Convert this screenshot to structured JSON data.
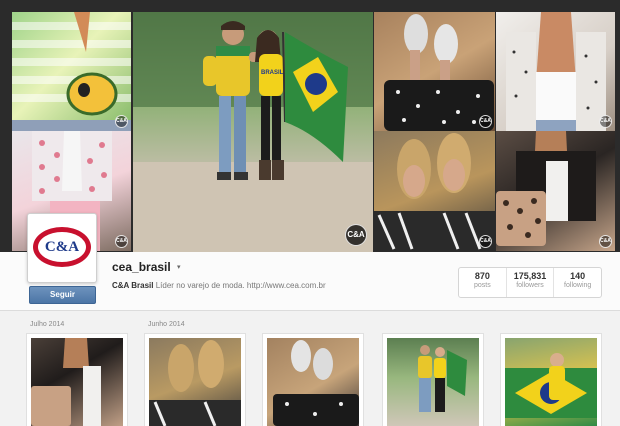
{
  "cover": {
    "photos": [
      {
        "id": "cover-1",
        "watermark": "C&A"
      },
      {
        "id": "cover-2",
        "watermark": "C&A"
      },
      {
        "id": "cover-3",
        "watermark": "C&A"
      },
      {
        "id": "cover-4",
        "watermark": "C&A"
      },
      {
        "id": "cover-5",
        "watermark": "C&A"
      },
      {
        "id": "cover-6",
        "watermark": "C&A"
      },
      {
        "id": "cover-7",
        "watermark": "C&A"
      }
    ],
    "shirt_text": "BRASIL"
  },
  "profile": {
    "logo_text": "C&A",
    "username": "cea_brasil",
    "caret": "▾",
    "bio_name": "C&A Brasil",
    "bio_text": "Líder no varejo de moda.",
    "bio_url": "http://www.cea.com.br",
    "follow_label": "Seguir",
    "stats": [
      {
        "value": "870",
        "label": "posts"
      },
      {
        "value": "175,831",
        "label": "followers"
      },
      {
        "value": "140",
        "label": "following"
      }
    ]
  },
  "feed": {
    "months": [
      "Julho 2014",
      "Junho 2014"
    ]
  },
  "colors": {
    "logo_red": "#c8102e",
    "logo_blue": "#1e3a8a",
    "button_blue": "#4c75a6",
    "brazil_green": "#2e8b3e",
    "brazil_yellow": "#f2d21b"
  }
}
